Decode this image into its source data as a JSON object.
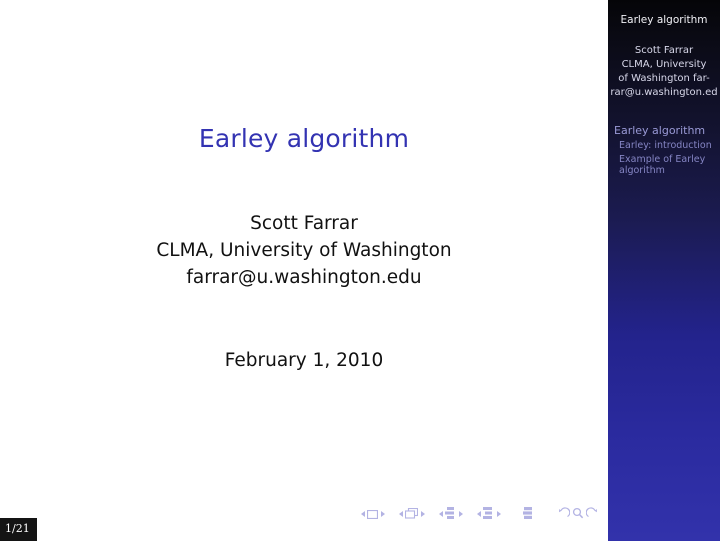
{
  "slide": {
    "title": "Earley algorithm",
    "author_lines": [
      "Scott Farrar",
      "CLMA, University of Washington",
      "farrar@u.washington.edu"
    ],
    "date": "February 1, 2010"
  },
  "sidebar": {
    "title": "Earley algorithm",
    "author_lines": [
      "Scott Farrar",
      "CLMA, University",
      "of Washington far-",
      "rar@u.washington.ed"
    ],
    "toc": [
      {
        "label": "Earley algorithm",
        "level": "section",
        "children": [
          {
            "label": "Earley: introduction",
            "level": "subsection"
          },
          {
            "label": "Example of Earley algorithm",
            "level": "subsection"
          }
        ]
      }
    ]
  },
  "navigation": {
    "groups": [
      {
        "icon": "slide-nav-icon",
        "label": "slide"
      },
      {
        "icon": "frame-nav-icon",
        "label": "frame"
      },
      {
        "icon": "subsection-nav-icon",
        "label": "subsection"
      },
      {
        "icon": "section-nav-icon",
        "label": "section"
      }
    ],
    "presentation": {
      "icon": "presentation-nav-icon",
      "label": "presentation"
    },
    "tools": [
      {
        "icon": "back-icon",
        "label": "back"
      },
      {
        "icon": "search-icon",
        "label": "search"
      },
      {
        "icon": "forward-icon",
        "label": "forward"
      }
    ]
  },
  "page_badge": {
    "text": "1/21"
  },
  "colors": {
    "title": "#3333b2",
    "body_text": "#111111",
    "sidebar_top": "#050508",
    "sidebar_bottom": "#3232ab",
    "sidebar_section": "#9a9ad6",
    "sidebar_subsection": "#8585c4",
    "nav_symbol": "#4b4bbe",
    "badge_bg": "#141414",
    "badge_text": "#ffffff"
  }
}
